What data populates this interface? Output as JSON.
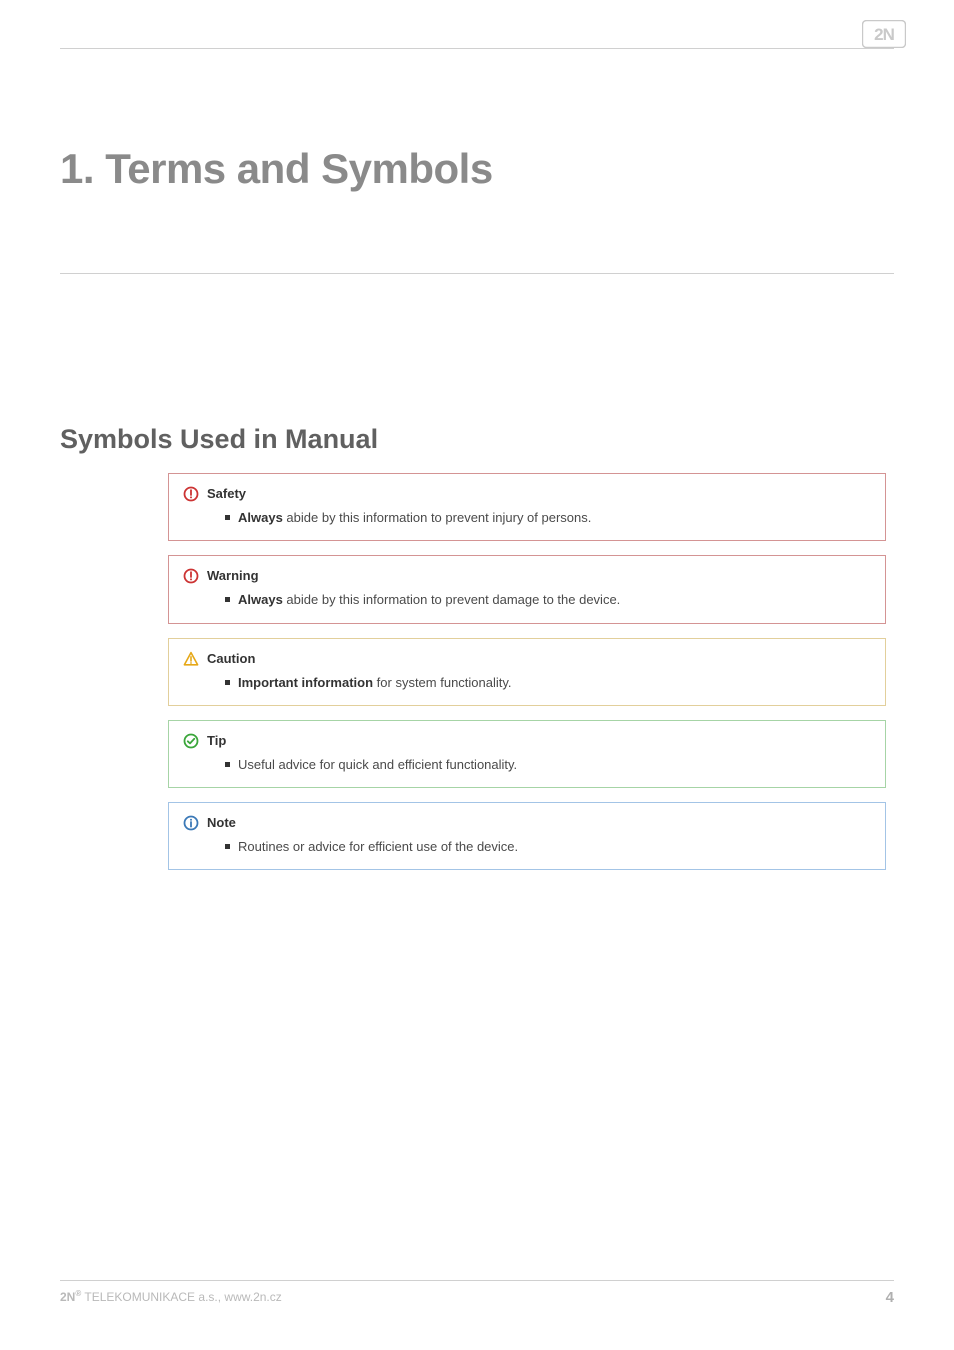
{
  "brand": {
    "logo_text": "2N"
  },
  "page_title": "1. Terms and Symbols",
  "section_title": "Symbols Used in Manual",
  "callouts": {
    "safety": {
      "title": "Safety",
      "body_prefix": "Always",
      "body_rest": " abide by this information to prevent injury of persons."
    },
    "warning": {
      "title": "Warning",
      "body_prefix": "Always",
      "body_rest": " abide by this information to prevent damage to the device."
    },
    "caution": {
      "title": "Caution",
      "body_prefix": "Important information",
      "body_rest": " for system functionality."
    },
    "tip": {
      "title": "Tip",
      "body_prefix": "",
      "body_rest": "Useful advice for quick and efficient functionality."
    },
    "note": {
      "title": "Note",
      "body_prefix": "",
      "body_rest": "Routines or advice for efficient use of the device."
    }
  },
  "footer": {
    "company": "2N",
    "reg_mark": "®",
    "rest": " TELEKOMUNIKACE a.s., www.2n.cz",
    "page_number": "4"
  },
  "colors": {
    "error": "#cc3333",
    "warn": "#e6a817",
    "success": "#3aa63a",
    "info": "#3b79b7"
  }
}
